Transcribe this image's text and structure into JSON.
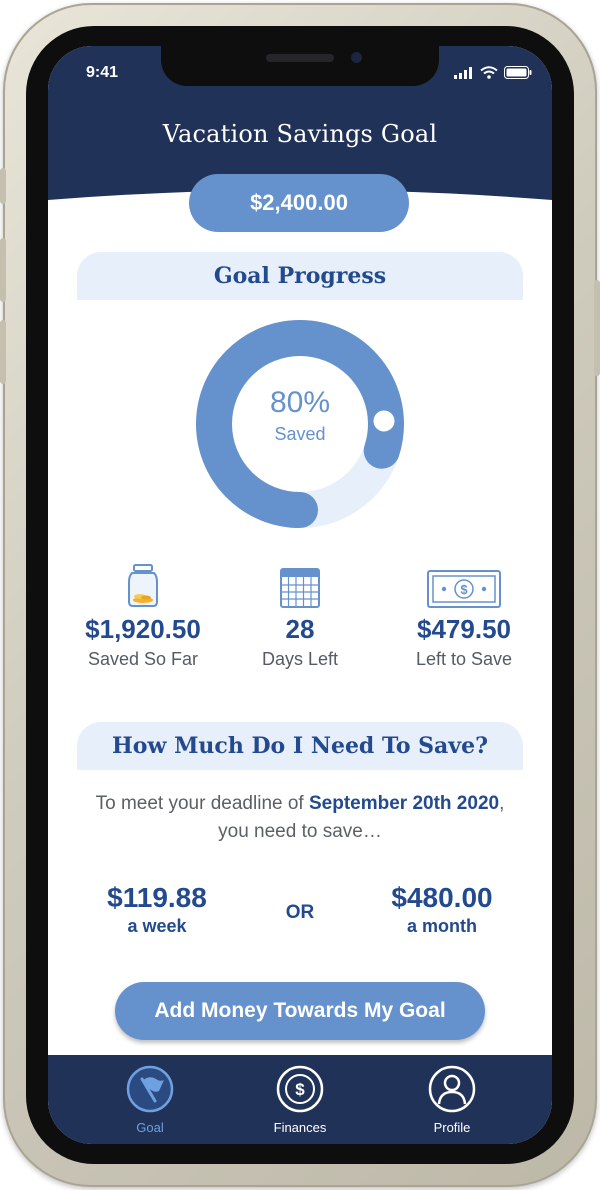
{
  "status_bar": {
    "time": "9:41"
  },
  "header": {
    "title": "Vacation Savings Goal",
    "goal_amount": "$2,400.00"
  },
  "progress": {
    "section_title": "Goal Progress",
    "percent_label": "80%",
    "percent_value": 0.8,
    "caption": "Saved"
  },
  "stats": [
    {
      "icon": "jar-icon",
      "value": "$1,920.50",
      "label": "Saved So Far"
    },
    {
      "icon": "calendar-icon",
      "value": "28",
      "label": "Days Left"
    },
    {
      "icon": "cash-icon",
      "value": "$479.50",
      "label": "Left to Save"
    }
  ],
  "savings_plan": {
    "section_title": "How Much Do I Need To Save?",
    "text_before": "To meet your deadline of ",
    "deadline": "September 20th 2020",
    "text_after": ", you need to save…",
    "weekly_amount": "$119.88",
    "weekly_unit": "a week",
    "or_label": "OR",
    "monthly_amount": "$480.00",
    "monthly_unit": "a month"
  },
  "cta": {
    "label": "Add Money Towards My Goal"
  },
  "tabs": [
    {
      "label": "Goal",
      "icon": "flag-icon",
      "active": true
    },
    {
      "label": "Finances",
      "icon": "dollar-coin-icon",
      "active": false
    },
    {
      "label": "Profile",
      "icon": "user-icon",
      "active": false
    }
  ],
  "colors": {
    "navy": "#213259",
    "accent_blue": "#6592cc",
    "dark_blue_text": "#234a8e",
    "light_band": "#e6effa",
    "active_tab": "#6fa0e0"
  }
}
